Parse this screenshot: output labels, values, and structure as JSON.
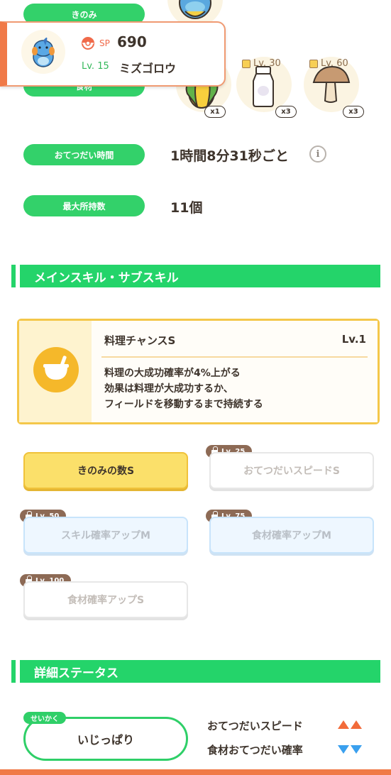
{
  "info_rows": {
    "berry_label": "きのみ",
    "ingredient_label": "食材",
    "help_time_label": "おてつだい時間",
    "help_time_value": "1時間8分31秒ごと",
    "max_carry_label": "最大所持数",
    "max_carry_value": "11個"
  },
  "ingredients": [
    {
      "count": "x1",
      "lv": ""
    },
    {
      "count": "x3",
      "lv": "Lv. 30"
    },
    {
      "count": "x3",
      "lv": "Lv. 60"
    }
  ],
  "pokemon_popup": {
    "sp_label": "SP",
    "sp_value": "690",
    "level": "Lv. 15",
    "name": "ミズゴロウ"
  },
  "skills_section": {
    "title": "メインスキル・サブスキル"
  },
  "main_skill": {
    "name": "料理チャンスS",
    "level": "Lv.1",
    "description": [
      "料理の大成功確率が4%上がる",
      "効果は料理が大成功するか、",
      "フィールドを移動するまで持続する"
    ]
  },
  "sub_skills": [
    {
      "label": "きのみの数S",
      "lock_level": ""
    },
    {
      "label": "おてつだいスピードS",
      "lock_level": "Lv. 25"
    },
    {
      "label": "スキル確率アップM",
      "lock_level": "Lv. 50"
    },
    {
      "label": "食材確率アップM",
      "lock_level": "Lv. 75"
    },
    {
      "label": "食材確率アップS",
      "lock_level": "Lv. 100"
    }
  ],
  "detail_section": {
    "title": "詳細ステータス"
  },
  "nature": {
    "tag": "せいかく",
    "value": "いじっぱり",
    "up_stat": "おてつだいスピード",
    "down_stat": "食材おてつだい確率"
  },
  "colors": {
    "green": "#33d16a",
    "orange": "#f07a48",
    "gold": "#f4c74a",
    "up": "#f26b3a",
    "down": "#3aa0ee"
  }
}
